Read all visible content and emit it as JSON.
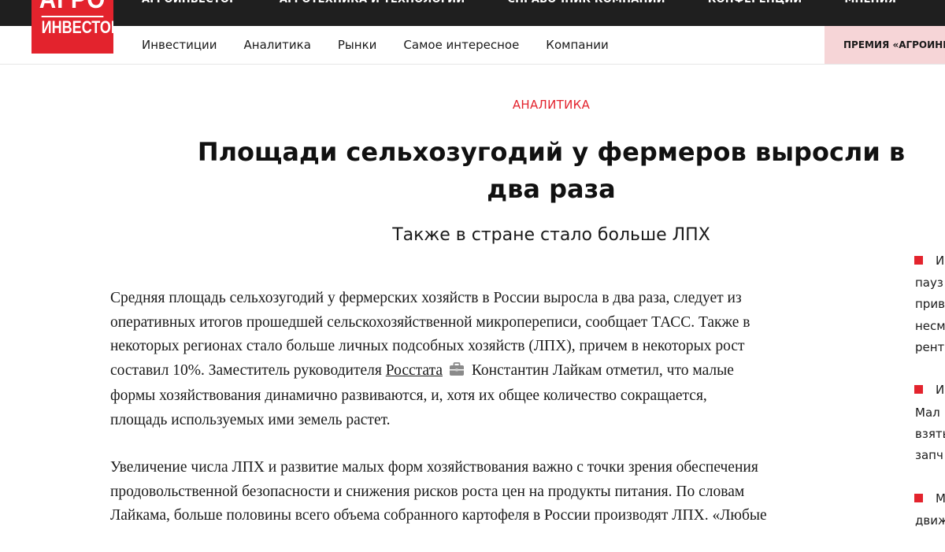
{
  "logo": {
    "line1": "АГРО",
    "line2": "ИНВЕСТОР"
  },
  "top_nav": [
    "АГРОИНВЕСТОР",
    "АГРОТЕХНИКА И ТЕХНОЛОГИИ",
    "СПРАВОЧНИК КОМПАНИЙ",
    "КОНФЕРЕНЦИИ",
    "МНЕНИЯ"
  ],
  "sub_nav": [
    "Инвестиции",
    "Аналитика",
    "Рынки",
    "Самое интересное",
    "Компании"
  ],
  "premium_label": "ПРЕМИЯ «АГРОИНЕ",
  "article": {
    "category": "АНАЛИТИКА",
    "title": "Площади сельхозугодий у фермеров выросли в два раза",
    "subtitle": "Также в стране стало больше ЛПХ",
    "p1_l1": "Средняя площадь сельхозугодий у фермерских хозяйств в России выросла в два раза, следует из",
    "p1_l2": "оперативных итогов прошедшей сельскохозяйственной микропереписи, сообщает ТАСС. Также в",
    "p1_l3": "некоторых регионах стало больше личных подсобных хозяйств (ЛПХ), причем в некоторых рост",
    "p1_l4_a": "составил 10%. Заместитель руководителя",
    "p1_l4_link": "Росстата",
    "p1_l4_b": "Константин Лайкам отметил, что малые",
    "p1_l5": "формы хозяйствования динамично развиваются, и, хотя их общее количество сокращается,",
    "p1_l6": "площадь используемых ими земель растет.",
    "p2_l1": "Увеличение числа ЛПХ и развитие малых форм хозяйствования важно с точки зрения обеспечения",
    "p2_l2": "продовольственной безопасности и снижения рисков роста цен на продукты питания. По словам",
    "p2_l3": "Лайкама, больше половины всего объема собранного картофеля в России производят ЛПХ. «Любые"
  },
  "sidebar": {
    "item1": {
      "head": "И",
      "lines": [
        "пауз",
        "прив",
        "несм",
        "рент"
      ]
    },
    "item2": {
      "head": "И",
      "lines": [
        "Мал",
        "взять",
        "запч"
      ]
    },
    "item3": {
      "head": "М",
      "lines": [
        "движ"
      ]
    }
  },
  "colors": {
    "accent": "#e3232d",
    "topbar": "#1f1f1f",
    "premium_bg": "#f6d5d7"
  },
  "icons": {
    "company_link": "briefcase-icon"
  }
}
